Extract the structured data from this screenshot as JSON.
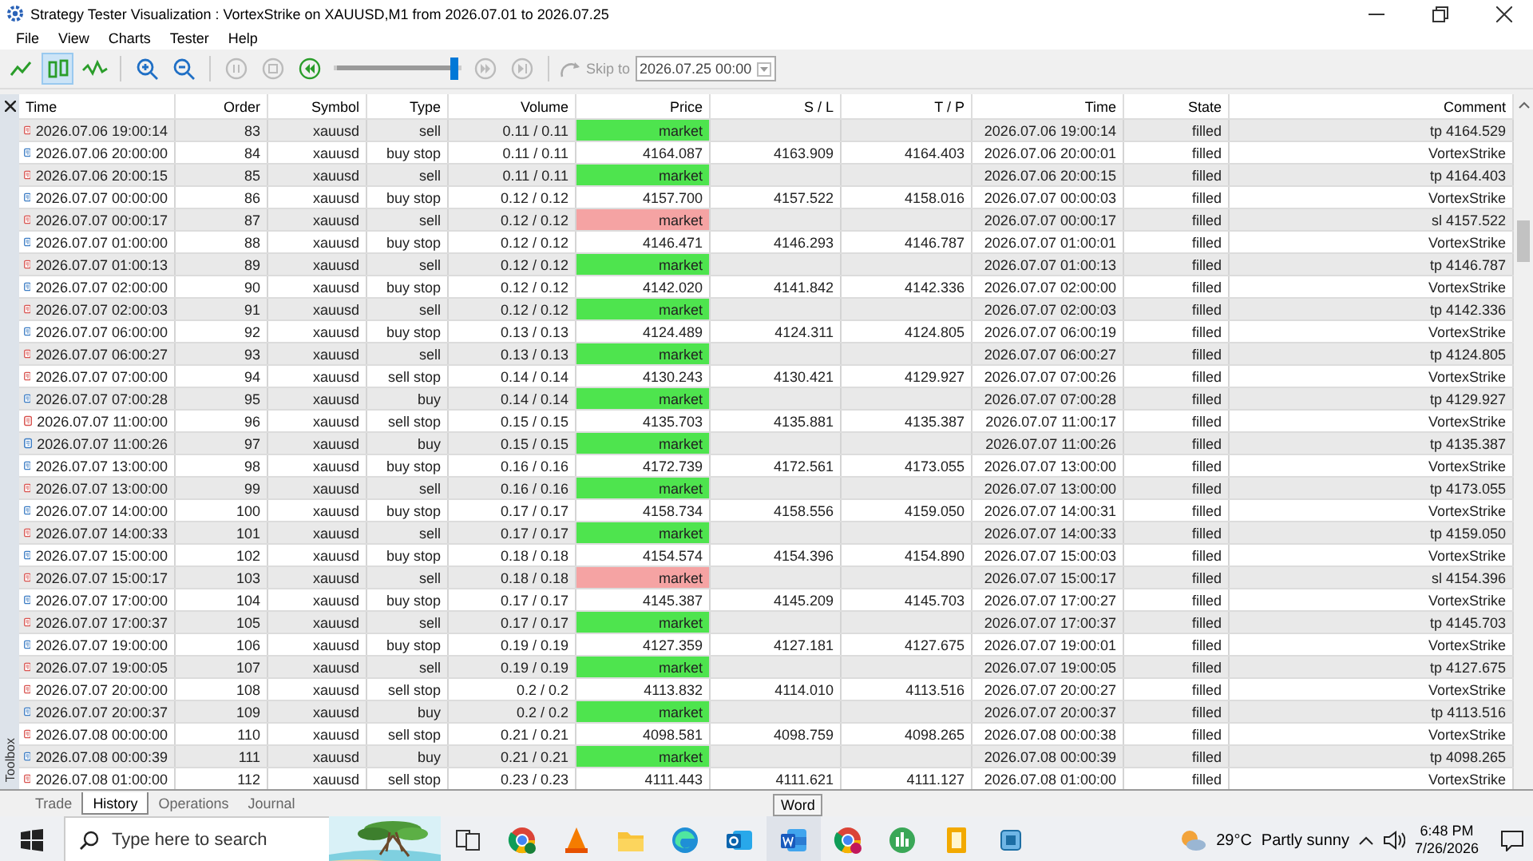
{
  "window": {
    "title": "Strategy Tester Visualization : VortexStrike on XAUUSD,M1 from 2026.07.01 to 2026.07.25"
  },
  "menu": [
    "File",
    "View",
    "Charts",
    "Tester",
    "Help"
  ],
  "toolbar": {
    "chart_modes": [
      {
        "selected": false
      },
      {
        "selected": true
      },
      {
        "selected": false
      }
    ],
    "speed": {
      "level": 0.97
    },
    "skip_label": "Skip to",
    "skip_date": "2026.07.25 00:00"
  },
  "side_panel": {
    "title": "Toolbox"
  },
  "table": {
    "columns": [
      "Time",
      "Order",
      "Symbol",
      "Type",
      "Volume",
      "Price",
      "S / L",
      "T / P",
      "Time",
      "State",
      "Comment"
    ],
    "rows": [
      {
        "color": "#d9534f",
        "time": "2026.07.06 19:00:14",
        "order": "83",
        "symbol": "xauusd",
        "type": "sell",
        "volume": "0.11 / 0.11",
        "price": "market",
        "profit": true,
        "loss": false,
        "done_time": "2026.07.06 19:00:14",
        "state": "filled",
        "comment": "tp 4164.529"
      },
      {
        "color": "#3b7cc4",
        "time": "2026.07.06 20:00:00",
        "order": "84",
        "symbol": "xauusd",
        "type": "buy stop",
        "volume": "0.11 / 0.11",
        "price": "4164.087",
        "profit": false,
        "loss": false,
        "sl": "4163.909",
        "tp": "4164.403",
        "done_time": "2026.07.06 20:00:01",
        "state": "filled",
        "comment": "VortexStrike"
      },
      {
        "color": "#d9534f",
        "time": "2026.07.06 20:00:15",
        "order": "85",
        "symbol": "xauusd",
        "type": "sell",
        "volume": "0.11 / 0.11",
        "price": "market",
        "profit": true,
        "loss": false,
        "done_time": "2026.07.06 20:00:15",
        "state": "filled",
        "comment": "tp 4164.403"
      },
      {
        "color": "#3b7cc4",
        "time": "2026.07.07 00:00:00",
        "order": "86",
        "symbol": "xauusd",
        "type": "buy stop",
        "volume": "0.12 / 0.12",
        "price": "4157.700",
        "profit": false,
        "loss": false,
        "sl": "4157.522",
        "tp": "4158.016",
        "done_time": "2026.07.07 00:00:03",
        "state": "filled",
        "comment": "VortexStrike"
      },
      {
        "color": "#d9534f",
        "time": "2026.07.07 00:00:17",
        "order": "87",
        "symbol": "xauusd",
        "type": "sell",
        "volume": "0.12 / 0.12",
        "price": "market",
        "profit": false,
        "loss": true,
        "done_time": "2026.07.07 00:00:17",
        "state": "filled",
        "comment": "sl 4157.522"
      },
      {
        "color": "#3b7cc4",
        "time": "2026.07.07 01:00:00",
        "order": "88",
        "symbol": "xauusd",
        "type": "buy stop",
        "volume": "0.12 / 0.12",
        "price": "4146.471",
        "profit": false,
        "loss": false,
        "sl": "4146.293",
        "tp": "4146.787",
        "done_time": "2026.07.07 01:00:01",
        "state": "filled",
        "comment": "VortexStrike"
      },
      {
        "color": "#d9534f",
        "time": "2026.07.07 01:00:13",
        "order": "89",
        "symbol": "xauusd",
        "type": "sell",
        "volume": "0.12 / 0.12",
        "price": "market",
        "profit": true,
        "loss": false,
        "done_time": "2026.07.07 01:00:13",
        "state": "filled",
        "comment": "tp 4146.787"
      },
      {
        "color": "#3b7cc4",
        "time": "2026.07.07 02:00:00",
        "order": "90",
        "symbol": "xauusd",
        "type": "buy stop",
        "volume": "0.12 / 0.12",
        "price": "4142.020",
        "profit": false,
        "loss": false,
        "sl": "4141.842",
        "tp": "4142.336",
        "done_time": "2026.07.07 02:00:00",
        "state": "filled",
        "comment": "VortexStrike"
      },
      {
        "color": "#d9534f",
        "time": "2026.07.07 02:00:03",
        "order": "91",
        "symbol": "xauusd",
        "type": "sell",
        "volume": "0.12 / 0.12",
        "price": "market",
        "profit": true,
        "loss": false,
        "done_time": "2026.07.07 02:00:03",
        "state": "filled",
        "comment": "tp 4142.336"
      },
      {
        "color": "#3b7cc4",
        "time": "2026.07.07 06:00:00",
        "order": "92",
        "symbol": "xauusd",
        "type": "buy stop",
        "volume": "0.13 / 0.13",
        "price": "4124.489",
        "profit": false,
        "loss": false,
        "sl": "4124.311",
        "tp": "4124.805",
        "done_time": "2026.07.07 06:00:19",
        "state": "filled",
        "comment": "VortexStrike"
      },
      {
        "color": "#d9534f",
        "time": "2026.07.07 06:00:27",
        "order": "93",
        "symbol": "xauusd",
        "type": "sell",
        "volume": "0.13 / 0.13",
        "price": "market",
        "profit": true,
        "loss": false,
        "done_time": "2026.07.07 06:00:27",
        "state": "filled",
        "comment": "tp 4124.805"
      },
      {
        "color": "#d9534f",
        "time": "2026.07.07 07:00:00",
        "order": "94",
        "symbol": "xauusd",
        "type": "sell stop",
        "volume": "0.14 / 0.14",
        "price": "4130.243",
        "profit": false,
        "loss": false,
        "sl": "4130.421",
        "tp": "4129.927",
        "done_time": "2026.07.07 07:00:26",
        "state": "filled",
        "comment": "VortexStrike"
      },
      {
        "color": "#3b7cc4",
        "time": "2026.07.07 07:00:28",
        "order": "95",
        "symbol": "xauusd",
        "type": "buy",
        "volume": "0.14 / 0.14",
        "price": "market",
        "profit": true,
        "loss": false,
        "done_time": "2026.07.07 07:00:28",
        "state": "filled",
        "comment": "tp 4129.927"
      },
      {
        "color": "#d9534f",
        "time": "2026.07.07 11:00:00",
        "order": "96",
        "symbol": "xauusd",
        "type": "sell stop",
        "volume": "0.15 / 0.15",
        "price": "4135.703",
        "profit": false,
        "loss": false,
        "sl": "4135.881",
        "tp": "4135.387",
        "done_time": "2026.07.07 11:00:17",
        "state": "filled",
        "comment": "VortexStrike"
      },
      {
        "color": "#3b7cc4",
        "time": "2026.07.07 11:00:26",
        "order": "97",
        "symbol": "xauusd",
        "type": "buy",
        "volume": "0.15 / 0.15",
        "price": "market",
        "profit": true,
        "loss": false,
        "done_time": "2026.07.07 11:00:26",
        "state": "filled",
        "comment": "tp 4135.387"
      },
      {
        "color": "#3b7cc4",
        "time": "2026.07.07 13:00:00",
        "order": "98",
        "symbol": "xauusd",
        "type": "buy stop",
        "volume": "0.16 / 0.16",
        "price": "4172.739",
        "profit": false,
        "loss": false,
        "sl": "4172.561",
        "tp": "4173.055",
        "done_time": "2026.07.07 13:00:00",
        "state": "filled",
        "comment": "VortexStrike"
      },
      {
        "color": "#d9534f",
        "time": "2026.07.07 13:00:00",
        "order": "99",
        "symbol": "xauusd",
        "type": "sell",
        "volume": "0.16 / 0.16",
        "price": "market",
        "profit": true,
        "loss": false,
        "done_time": "2026.07.07 13:00:00",
        "state": "filled",
        "comment": "tp 4173.055"
      },
      {
        "color": "#3b7cc4",
        "time": "2026.07.07 14:00:00",
        "order": "100",
        "symbol": "xauusd",
        "type": "buy stop",
        "volume": "0.17 / 0.17",
        "price": "4158.734",
        "profit": false,
        "loss": false,
        "sl": "4158.556",
        "tp": "4159.050",
        "done_time": "2026.07.07 14:00:31",
        "state": "filled",
        "comment": "VortexStrike"
      },
      {
        "color": "#d9534f",
        "time": "2026.07.07 14:00:33",
        "order": "101",
        "symbol": "xauusd",
        "type": "sell",
        "volume": "0.17 / 0.17",
        "price": "market",
        "profit": true,
        "loss": false,
        "done_time": "2026.07.07 14:00:33",
        "state": "filled",
        "comment": "tp 4159.050"
      },
      {
        "color": "#3b7cc4",
        "time": "2026.07.07 15:00:00",
        "order": "102",
        "symbol": "xauusd",
        "type": "buy stop",
        "volume": "0.18 / 0.18",
        "price": "4154.574",
        "profit": false,
        "loss": false,
        "sl": "4154.396",
        "tp": "4154.890",
        "done_time": "2026.07.07 15:00:03",
        "state": "filled",
        "comment": "VortexStrike"
      },
      {
        "color": "#d9534f",
        "time": "2026.07.07 15:00:17",
        "order": "103",
        "symbol": "xauusd",
        "type": "sell",
        "volume": "0.18 / 0.18",
        "price": "market",
        "profit": false,
        "loss": true,
        "done_time": "2026.07.07 15:00:17",
        "state": "filled",
        "comment": "sl 4154.396"
      },
      {
        "color": "#3b7cc4",
        "time": "2026.07.07 17:00:00",
        "order": "104",
        "symbol": "xauusd",
        "type": "buy stop",
        "volume": "0.17 / 0.17",
        "price": "4145.387",
        "profit": false,
        "loss": false,
        "sl": "4145.209",
        "tp": "4145.703",
        "done_time": "2026.07.07 17:00:27",
        "state": "filled",
        "comment": "VortexStrike"
      },
      {
        "color": "#d9534f",
        "time": "2026.07.07 17:00:37",
        "order": "105",
        "symbol": "xauusd",
        "type": "sell",
        "volume": "0.17 / 0.17",
        "price": "market",
        "profit": true,
        "loss": false,
        "done_time": "2026.07.07 17:00:37",
        "state": "filled",
        "comment": "tp 4145.703"
      },
      {
        "color": "#3b7cc4",
        "time": "2026.07.07 19:00:00",
        "order": "106",
        "symbol": "xauusd",
        "type": "buy stop",
        "volume": "0.19 / 0.19",
        "price": "4127.359",
        "profit": false,
        "loss": false,
        "sl": "4127.181",
        "tp": "4127.675",
        "done_time": "2026.07.07 19:00:01",
        "state": "filled",
        "comment": "VortexStrike"
      },
      {
        "color": "#d9534f",
        "time": "2026.07.07 19:00:05",
        "order": "107",
        "symbol": "xauusd",
        "type": "sell",
        "volume": "0.19 / 0.19",
        "price": "market",
        "profit": true,
        "loss": false,
        "done_time": "2026.07.07 19:00:05",
        "state": "filled",
        "comment": "tp 4127.675"
      },
      {
        "color": "#d9534f",
        "time": "2026.07.07 20:00:00",
        "order": "108",
        "symbol": "xauusd",
        "type": "sell stop",
        "volume": "0.2 / 0.2",
        "price": "4113.832",
        "profit": false,
        "loss": false,
        "sl": "4114.010",
        "tp": "4113.516",
        "done_time": "2026.07.07 20:00:27",
        "state": "filled",
        "comment": "VortexStrike"
      },
      {
        "color": "#3b7cc4",
        "time": "2026.07.07 20:00:37",
        "order": "109",
        "symbol": "xauusd",
        "type": "buy",
        "volume": "0.2 / 0.2",
        "price": "market",
        "profit": true,
        "loss": false,
        "done_time": "2026.07.07 20:00:37",
        "state": "filled",
        "comment": "tp 4113.516"
      },
      {
        "color": "#d9534f",
        "time": "2026.07.08 00:00:00",
        "order": "110",
        "symbol": "xauusd",
        "type": "sell stop",
        "volume": "0.21 / 0.21",
        "price": "4098.581",
        "profit": false,
        "loss": false,
        "sl": "4098.759",
        "tp": "4098.265",
        "done_time": "2026.07.08 00:00:38",
        "state": "filled",
        "comment": "VortexStrike"
      },
      {
        "color": "#3b7cc4",
        "time": "2026.07.08 00:00:39",
        "order": "111",
        "symbol": "xauusd",
        "type": "buy",
        "volume": "0.21 / 0.21",
        "price": "market",
        "profit": true,
        "loss": false,
        "done_time": "2026.07.08 00:00:39",
        "state": "filled",
        "comment": "tp 4098.265"
      },
      {
        "color": "#d9534f",
        "time": "2026.07.08 01:00:00",
        "order": "112",
        "symbol": "xauusd",
        "type": "sell stop",
        "volume": "0.23 / 0.23",
        "price": "4111.443",
        "profit": false,
        "loss": false,
        "sl": "4111.621",
        "tp": "4111.127",
        "done_time": "2026.07.08 01:00:00",
        "state": "filled",
        "comment": "VortexStrike"
      }
    ]
  },
  "tabs": [
    {
      "label": "Trade",
      "selected": false
    },
    {
      "label": "History",
      "selected": true
    },
    {
      "label": "Operations",
      "selected": false
    },
    {
      "label": "Journal",
      "selected": false
    }
  ],
  "taskbar": {
    "search": {
      "placeholder": "Type here to search"
    },
    "apps": [
      {
        "kind": "taskview"
      },
      {
        "kind": "browser"
      },
      {
        "kind": "cone"
      },
      {
        "kind": "folder"
      },
      {
        "kind": "edge"
      },
      {
        "kind": "mail"
      },
      {
        "kind": "word"
      },
      {
        "kind": "browser"
      },
      {
        "kind": "trader"
      },
      {
        "kind": "notes"
      },
      {
        "kind": "chip"
      }
    ],
    "tooltip": "Word",
    "weather": {
      "temp": "29°C",
      "text": "Partly sunny"
    },
    "clock": {
      "time": "6:48 PM",
      "date": "7/26/2026"
    }
  }
}
